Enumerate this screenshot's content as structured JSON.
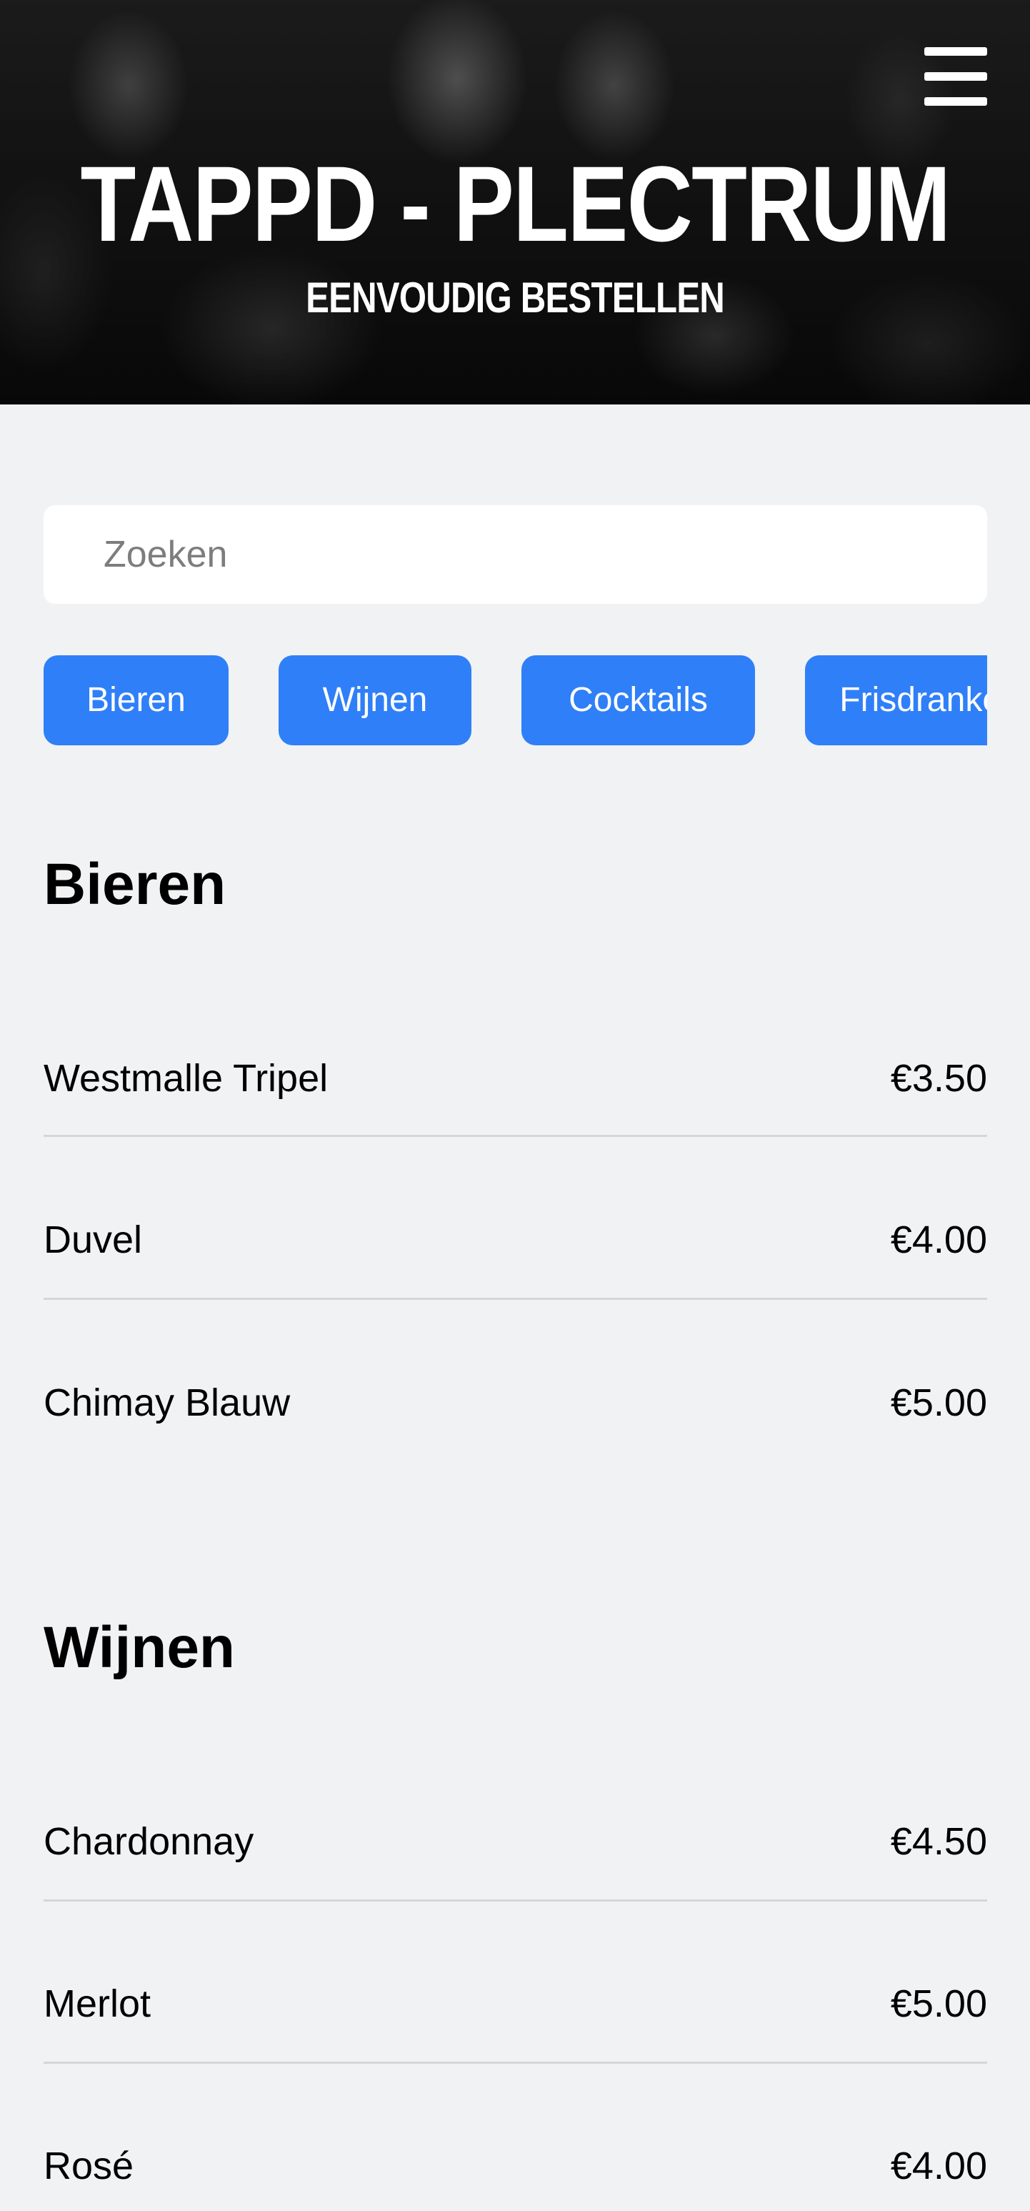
{
  "header": {
    "title": "TAPPD - PLECTRUM",
    "subtitle": "EENVOUDIG BESTELLEN",
    "menu_icon": "hamburger-menu-icon"
  },
  "search": {
    "placeholder": "Zoeken",
    "value": ""
  },
  "categories": [
    "Bieren",
    "Wijnen",
    "Cocktails",
    "Frisdranken"
  ],
  "sections": [
    {
      "title": "Bieren",
      "items": [
        {
          "name": "Westmalle Tripel",
          "price": "€3.50"
        },
        {
          "name": "Duvel",
          "price": "€4.00"
        },
        {
          "name": "Chimay Blauw",
          "price": "€5.00"
        }
      ]
    },
    {
      "title": "Wijnen",
      "items": [
        {
          "name": "Chardonnay",
          "price": "€4.50"
        },
        {
          "name": "Merlot",
          "price": "€5.00"
        },
        {
          "name": "Rosé",
          "price": "€4.00"
        }
      ]
    }
  ],
  "colors": {
    "accent": "#2f7ff8",
    "page_background": "#f1f2f4",
    "divider": "#d6d6d8"
  }
}
